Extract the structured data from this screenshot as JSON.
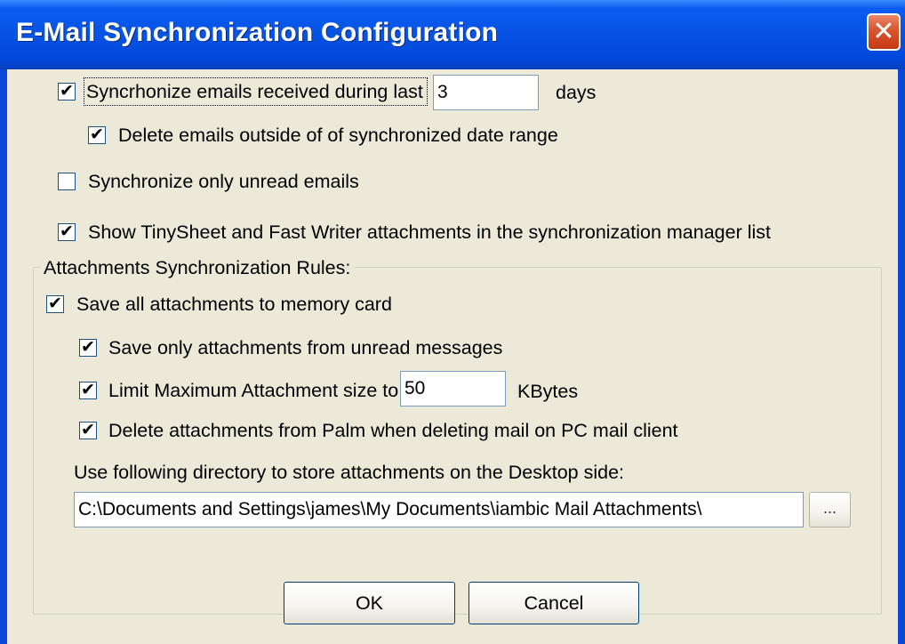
{
  "window": {
    "title": "E-Mail Synchronization Configuration",
    "close_glyph": "✕"
  },
  "options": {
    "sync_days": {
      "label": "Syncrhonize emails received during last",
      "checked": true,
      "value": "3",
      "suffix": "days"
    },
    "delete_outside": {
      "label": "Delete emails outside of of synchronized date range",
      "checked": true
    },
    "only_unread": {
      "label": "Synchronize only unread emails",
      "checked": false
    },
    "show_attachments": {
      "label": "Show TinySheet and Fast Writer attachments in the synchronization manager list",
      "checked": true
    }
  },
  "attachments": {
    "group_title": "Attachments Synchronization Rules:",
    "save_all": {
      "label": "Save all attachments to memory card",
      "checked": true
    },
    "save_unread": {
      "label": "Save only attachments from unread messages",
      "checked": true
    },
    "limit_size": {
      "label": "Limit Maximum Attachment size to",
      "checked": true,
      "value": "50",
      "suffix": "KBytes"
    },
    "delete_palm": {
      "label": "Delete attachments from Palm when deleting mail on PC mail client",
      "checked": true
    },
    "directory_label": "Use following directory to store attachments on the Desktop side:",
    "directory_value": "C:\\Documents and Settings\\james\\My Documents\\iambic Mail Attachments\\",
    "browse_label": "..."
  },
  "buttons": {
    "ok": "OK",
    "cancel": "Cancel"
  },
  "colors": {
    "titlebar": "#0753e3",
    "dialog_bg": "#ece9d8",
    "close_button": "#d9542d"
  }
}
